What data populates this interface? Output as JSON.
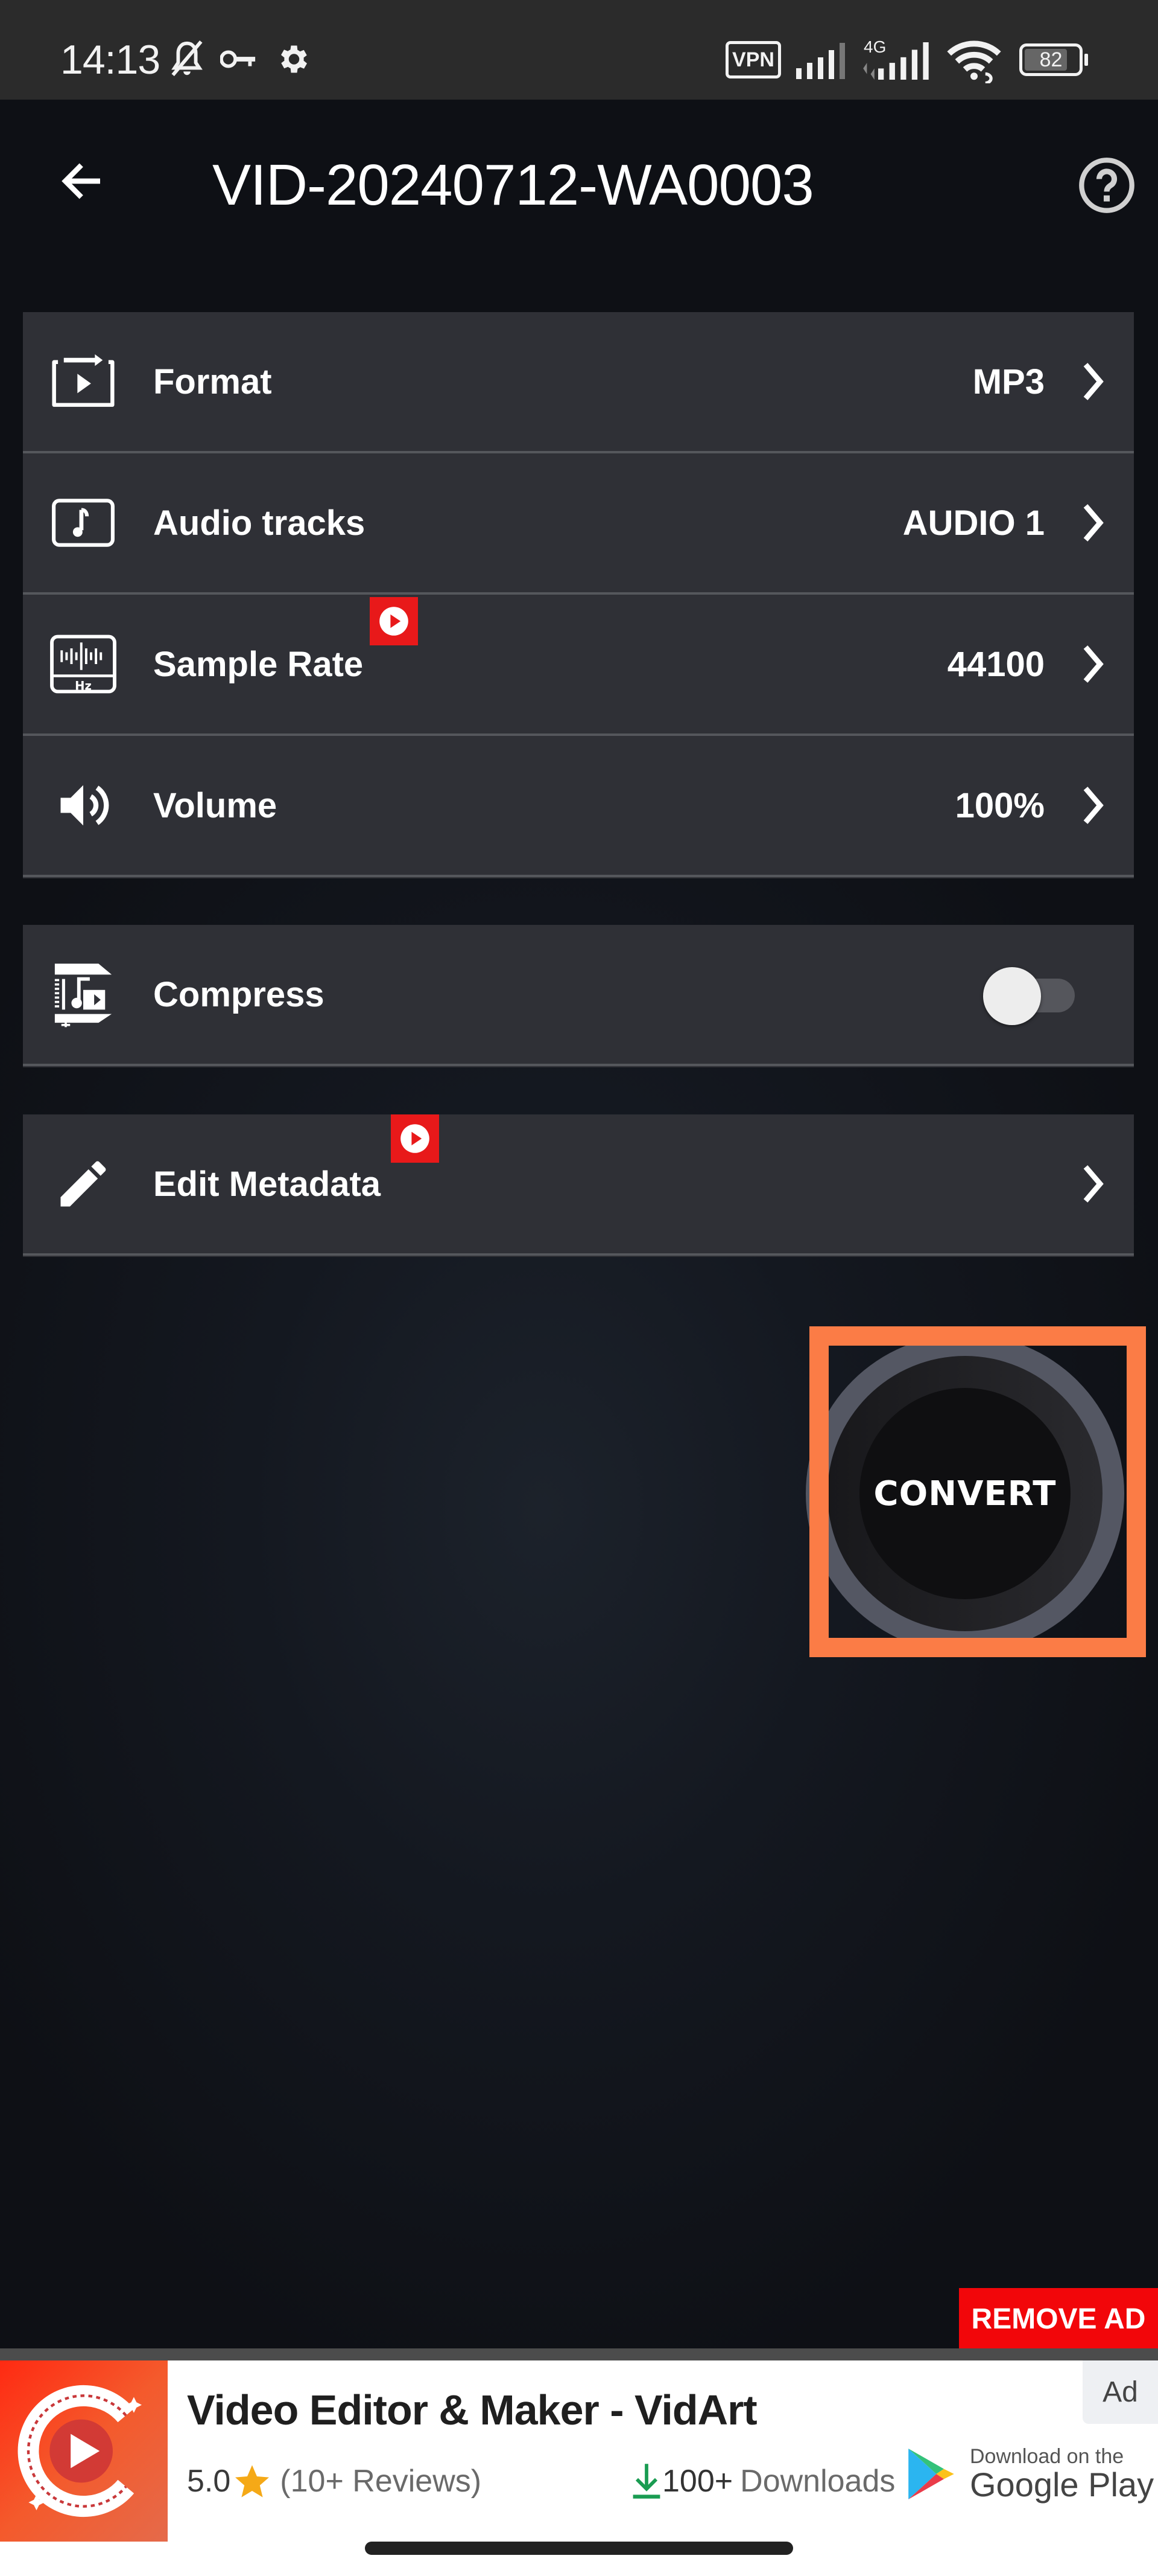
{
  "status_bar": {
    "time": "14:13",
    "left_icons": [
      "bell-off-icon",
      "key-icon",
      "gear-icon"
    ],
    "right_icons": [
      "vpn-icon",
      "signal-icon",
      "4g-signal-icon",
      "wifi-icon",
      "battery-icon"
    ],
    "vpn_label": "VPN",
    "network_label": "4G",
    "battery": "82"
  },
  "header": {
    "title": "VID-20240712-WA0003",
    "back_icon": "arrow-left-icon",
    "help_icon": "help-circle-icon"
  },
  "settings": {
    "rows": [
      {
        "label": "Format",
        "value": "MP3",
        "icon": "format-convert-icon",
        "ad_badge": false
      },
      {
        "label": "Audio tracks",
        "value": "AUDIO 1",
        "icon": "music-note-icon",
        "ad_badge": false
      },
      {
        "label": "Sample Rate",
        "value": "44100",
        "icon": "sample-rate-hz-icon",
        "ad_badge": true
      },
      {
        "label": "Volume",
        "value": "100%",
        "icon": "volume-icon",
        "ad_badge": false
      }
    ]
  },
  "compress": {
    "label": "Compress",
    "enabled": false,
    "icon": "compress-icon"
  },
  "metadata": {
    "label": "Edit Metadata",
    "icon": "pencil-icon",
    "ad_badge": true
  },
  "convert": {
    "label": "CONVERT"
  },
  "colors": {
    "highlight": "#fb7c46",
    "ad_badge": "#e8191a",
    "remove_ad": "#f2060a",
    "card_bg": "#2f3036"
  },
  "remove_ad": {
    "label": "REMOVE AD"
  },
  "ad": {
    "tag": "Ad",
    "title": "Video Editor & Maker - VidArt",
    "rating": "5.0",
    "reviews": "(10+ Reviews)",
    "downloads_count": "100+",
    "downloads_label": "Downloads",
    "store_small": "Download on the",
    "store_big": "Google Play"
  }
}
